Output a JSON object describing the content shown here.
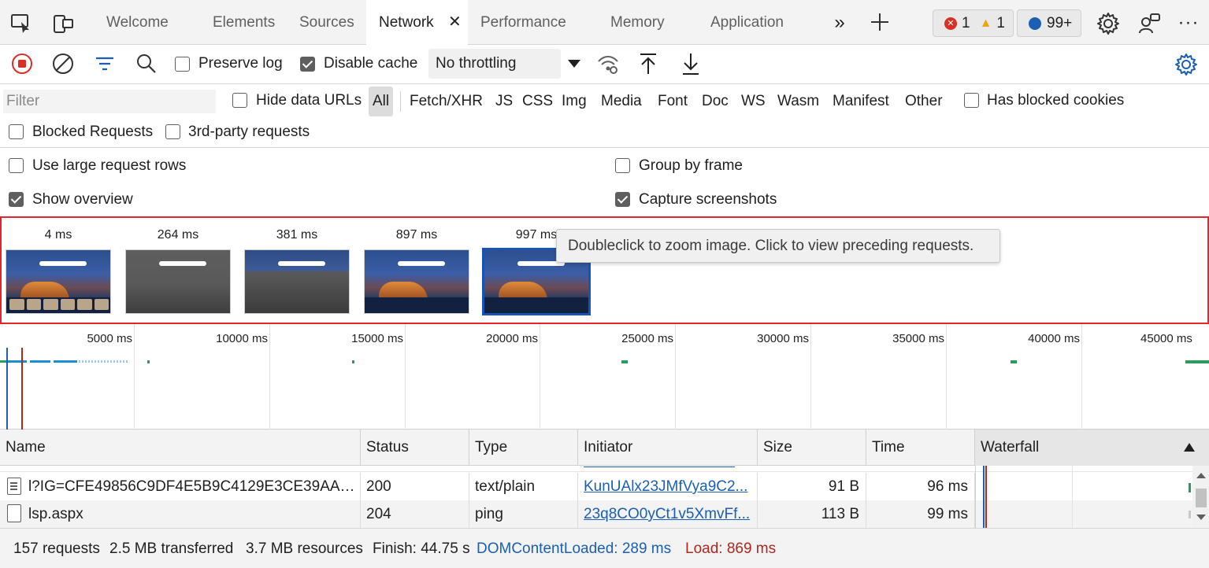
{
  "tabs": [
    {
      "label": "Welcome"
    },
    {
      "label": "Elements"
    },
    {
      "label": "Sources"
    },
    {
      "label": "Network"
    },
    {
      "label": "Performance"
    },
    {
      "label": "Memory"
    },
    {
      "label": "Application"
    }
  ],
  "issues": {
    "errors": "1",
    "warnings": "1",
    "messages": "99+"
  },
  "toolbar": {
    "preserve_log": "Preserve log",
    "disable_cache": "Disable cache",
    "throttling": "No throttling"
  },
  "filter": {
    "placeholder": "Filter",
    "hide_data_urls": "Hide data URLs",
    "types": [
      "All",
      "Fetch/XHR",
      "JS",
      "CSS",
      "Img",
      "Media",
      "Font",
      "Doc",
      "WS",
      "Wasm",
      "Manifest",
      "Other"
    ],
    "has_blocked_cookies": "Has blocked cookies",
    "blocked_requests": "Blocked Requests",
    "third_party": "3rd-party requests"
  },
  "settings": {
    "large_rows": "Use large request rows",
    "group_by_frame": "Group by frame",
    "show_overview": "Show overview",
    "capture_screenshots": "Capture screenshots"
  },
  "screenshots": {
    "times": [
      "4 ms",
      "264 ms",
      "381 ms",
      "897 ms",
      "997 ms"
    ],
    "tooltip": "Doubleclick to zoom image. Click to view preceding requests."
  },
  "overview": {
    "ticks": [
      "5000 ms",
      "10000 ms",
      "15000 ms",
      "20000 ms",
      "25000 ms",
      "30000 ms",
      "35000 ms",
      "40000 ms",
      "45000 ms"
    ]
  },
  "table": {
    "headers": [
      "Name",
      "Status",
      "Type",
      "Initiator",
      "Size",
      "Time",
      "Waterfall"
    ],
    "rows": [
      {
        "name": "l?IG=CFE49856C9DF4E5B9C4129E3CE39AA9E...",
        "status": "200",
        "type": "text/plain",
        "initiator": "KunUAlx23JMfVya9C2...",
        "size": "91 B",
        "time": "96 ms"
      },
      {
        "name": "lsp.aspx",
        "status": "204",
        "type": "ping",
        "initiator": "23q8CO0yCt1v5XmvFf...",
        "size": "113 B",
        "time": "99 ms"
      }
    ]
  },
  "status": {
    "requests": "157 requests",
    "transferred": "2.5 MB transferred",
    "resources": "3.7 MB resources",
    "finish": "Finish: 44.75 s",
    "domcontentloaded": "DOMContentLoaded: 289 ms",
    "load": "Load: 869 ms"
  },
  "colors": {
    "accent": "#1a5fb4",
    "error": "#d93025",
    "warning": "#f0a30a",
    "highlight_border": "#e5252b",
    "dcl": "#1a5fb4",
    "load": "#b3261e"
  }
}
